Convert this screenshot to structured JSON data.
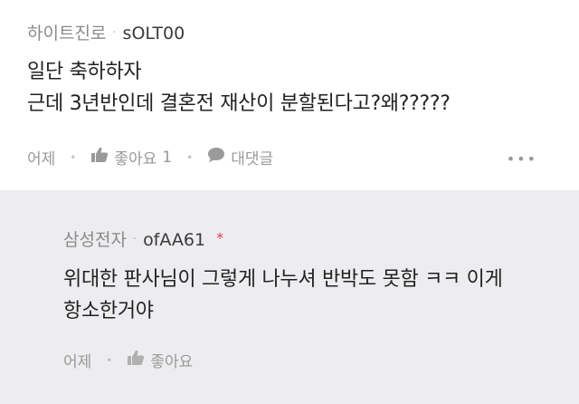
{
  "comments": [
    {
      "group": "하이트진로",
      "nickname": "sOLT00",
      "lines": [
        "일단 축하하자",
        "근데 3년반인데 결혼전  재산이 분할된다고?왜?????"
      ],
      "time": "어제",
      "like_label": "좋아요",
      "like_count": "1",
      "reply_label": "대댓글",
      "more_label": "•••"
    },
    {
      "group": "삼성전자",
      "nickname": "ofAA61",
      "star": "*",
      "lines": [
        "위대한 판사님이 그렇게 나누셔 반박도 못함 ㅋㅋ 이게",
        "항소한거야"
      ],
      "time": "어제",
      "like_label": "좋아요"
    }
  ],
  "colors": {
    "reply_bg": "#ededf0",
    "star": "#e0424b"
  }
}
